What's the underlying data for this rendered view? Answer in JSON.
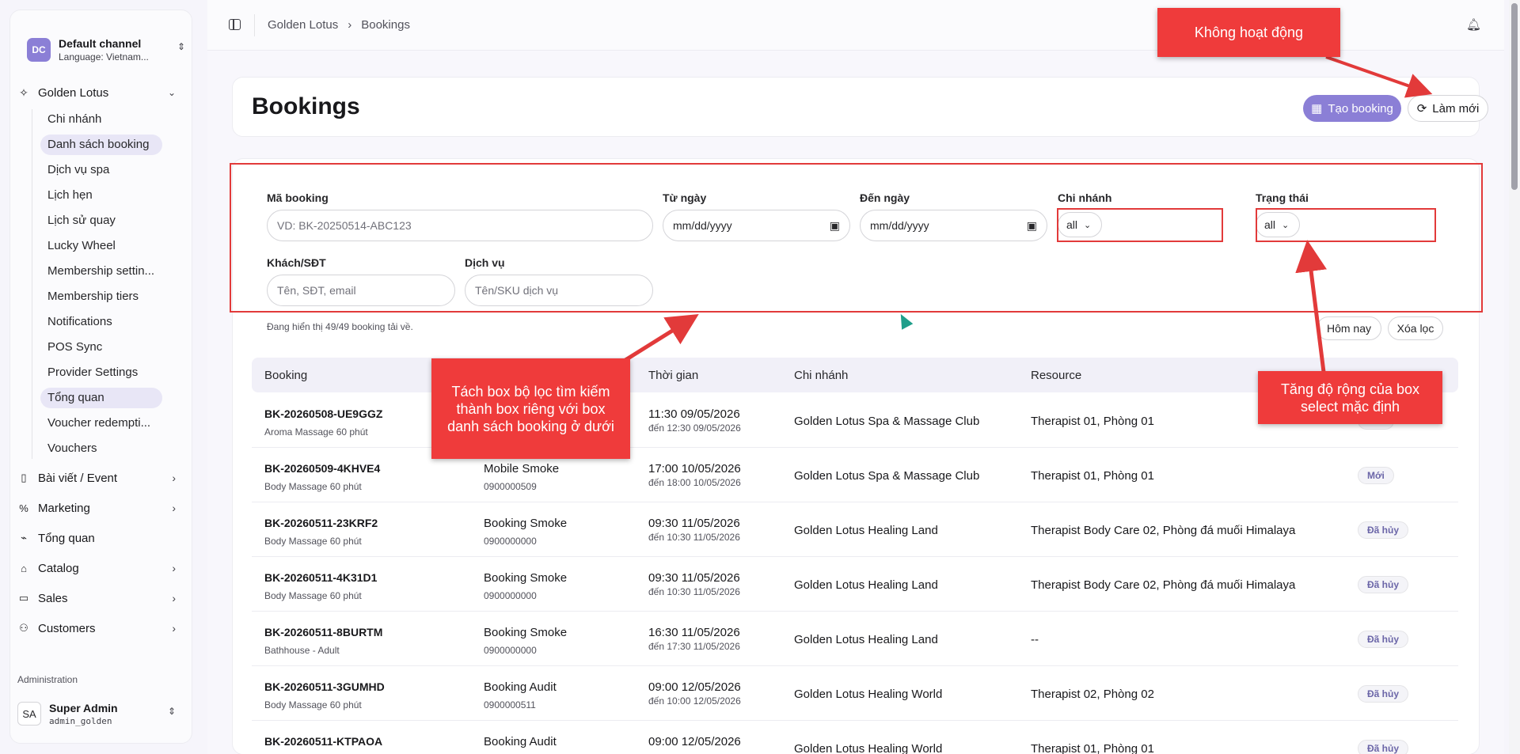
{
  "sidebar": {
    "channel": {
      "badge": "DC",
      "title": "Default channel",
      "subtitle": "Language: Vietnam..."
    },
    "group": {
      "label": "Golden Lotus",
      "icon": "sparkle-icon"
    },
    "sub_items": [
      "Chi nhánh",
      "Danh sách booking",
      "Dịch vụ spa",
      "Lịch hẹn",
      "Lịch sử quay",
      "Lucky Wheel",
      "Membership settin...",
      "Membership tiers",
      "Notifications",
      "POS Sync",
      "Provider Settings",
      "Tổng quan",
      "Voucher redempti...",
      "Vouchers"
    ],
    "active_index": 1,
    "highlight_index": 11,
    "items": [
      {
        "label": "Bài viết / Event",
        "icon": "phone-icon",
        "has_arrow": true
      },
      {
        "label": "Marketing",
        "icon": "percent-icon",
        "has_arrow": true
      },
      {
        "label": "Tổng quan",
        "icon": "chart-icon",
        "has_arrow": false
      },
      {
        "label": "Catalog",
        "icon": "tag-icon",
        "has_arrow": true
      },
      {
        "label": "Sales",
        "icon": "box-icon",
        "has_arrow": true
      },
      {
        "label": "Customers",
        "icon": "users-icon",
        "has_arrow": true
      }
    ],
    "admin_label": "Administration",
    "user": {
      "initials": "SA",
      "name": "Super Admin",
      "username": "admin_golden"
    }
  },
  "topbar": {
    "crumb1": "Golden Lotus",
    "crumb_sep": "›",
    "crumb2": "Bookings"
  },
  "header": {
    "title": "Bookings",
    "create_label": "Tạo booking",
    "refresh_label": "Làm mới"
  },
  "filters": {
    "code_label": "Mã booking",
    "code_placeholder": "VD: BK-20250514-ABC123",
    "from_label": "Từ ngày",
    "from_value": "mm/dd/yyyy",
    "to_label": "Đến ngày",
    "to_value": "mm/dd/yyyy",
    "branch_label": "Chi nhánh",
    "branch_value": "all",
    "status_label": "Trạng thái",
    "status_value": "all",
    "customer_label": "Khách/SĐT",
    "customer_placeholder": "Tên, SĐT, email",
    "service_label": "Dịch vụ",
    "service_placeholder": "Tên/SKU dịch vụ",
    "info": "Đang hiển thị 49/49 booking tải về.",
    "today_label": "Hôm nay",
    "clear_label": "Xóa lọc"
  },
  "table": {
    "headers": {
      "booking": "Booking",
      "time": "Thời gian",
      "branch": "Chi nhánh",
      "resource": "Resource"
    },
    "rows": [
      {
        "code": "BK-20260508-UE9GGZ",
        "service": "Aroma Massage 60 phút",
        "customer": "",
        "phone": "",
        "start": "11:30 09/05/2026",
        "end": "đến 12:30 09/05/2026",
        "branch": "Golden Lotus Spa & Massage Club",
        "resource": "Therapist 01, Phòng 01",
        "status": "Mới"
      },
      {
        "code": "BK-20260509-4KHVE4",
        "service": "Body Massage 60 phút",
        "customer": "Mobile Smoke",
        "phone": "0900000509",
        "start": "17:00 10/05/2026",
        "end": "đến 18:00 10/05/2026",
        "branch": "Golden Lotus Spa & Massage Club",
        "resource": "Therapist 01, Phòng 01",
        "status": "Mới"
      },
      {
        "code": "BK-20260511-23KRF2",
        "service": "Body Massage 60 phút",
        "customer": "Booking Smoke",
        "phone": "0900000000",
        "start": "09:30 11/05/2026",
        "end": "đến 10:30 11/05/2026",
        "branch": "Golden Lotus Healing Land",
        "resource": "Therapist Body Care 02, Phòng đá muối Himalaya",
        "status": "Đã hủy"
      },
      {
        "code": "BK-20260511-4K31D1",
        "service": "Body Massage 60 phút",
        "customer": "Booking Smoke",
        "phone": "0900000000",
        "start": "09:30 11/05/2026",
        "end": "đến 10:30 11/05/2026",
        "branch": "Golden Lotus Healing Land",
        "resource": "Therapist Body Care 02, Phòng đá muối Himalaya",
        "status": "Đã hủy"
      },
      {
        "code": "BK-20260511-8BURTM",
        "service": "Bathhouse - Adult",
        "customer": "Booking Smoke",
        "phone": "0900000000",
        "start": "16:30 11/05/2026",
        "end": "đến 17:30 11/05/2026",
        "branch": "Golden Lotus Healing Land",
        "resource": "--",
        "status": "Đã hủy"
      },
      {
        "code": "BK-20260511-3GUMHD",
        "service": "Body Massage 60 phút",
        "customer": "Booking Audit",
        "phone": "0900000511",
        "start": "09:00 12/05/2026",
        "end": "đến 10:00 12/05/2026",
        "branch": "Golden Lotus Healing World",
        "resource": "Therapist 02, Phòng 02",
        "status": "Đã hủy"
      },
      {
        "code": "BK-20260511-KTPAOA",
        "service": "",
        "customer": "Booking Audit",
        "phone": "",
        "start": "09:00 12/05/2026",
        "end": "",
        "branch": "Golden Lotus Healing World",
        "resource": "Therapist 01, Phòng 01",
        "status": "Đã hủy"
      }
    ]
  },
  "annotations": {
    "inactive": "Không hoạt động",
    "split": "Tách box bộ lọc tìm kiếm thành box riêng với box danh sách booking ở dưới",
    "widen": "Tăng độ rộng của box select mặc định"
  },
  "colors": {
    "accent": "#8b7fd6",
    "annotation": "#ef3b3b"
  }
}
